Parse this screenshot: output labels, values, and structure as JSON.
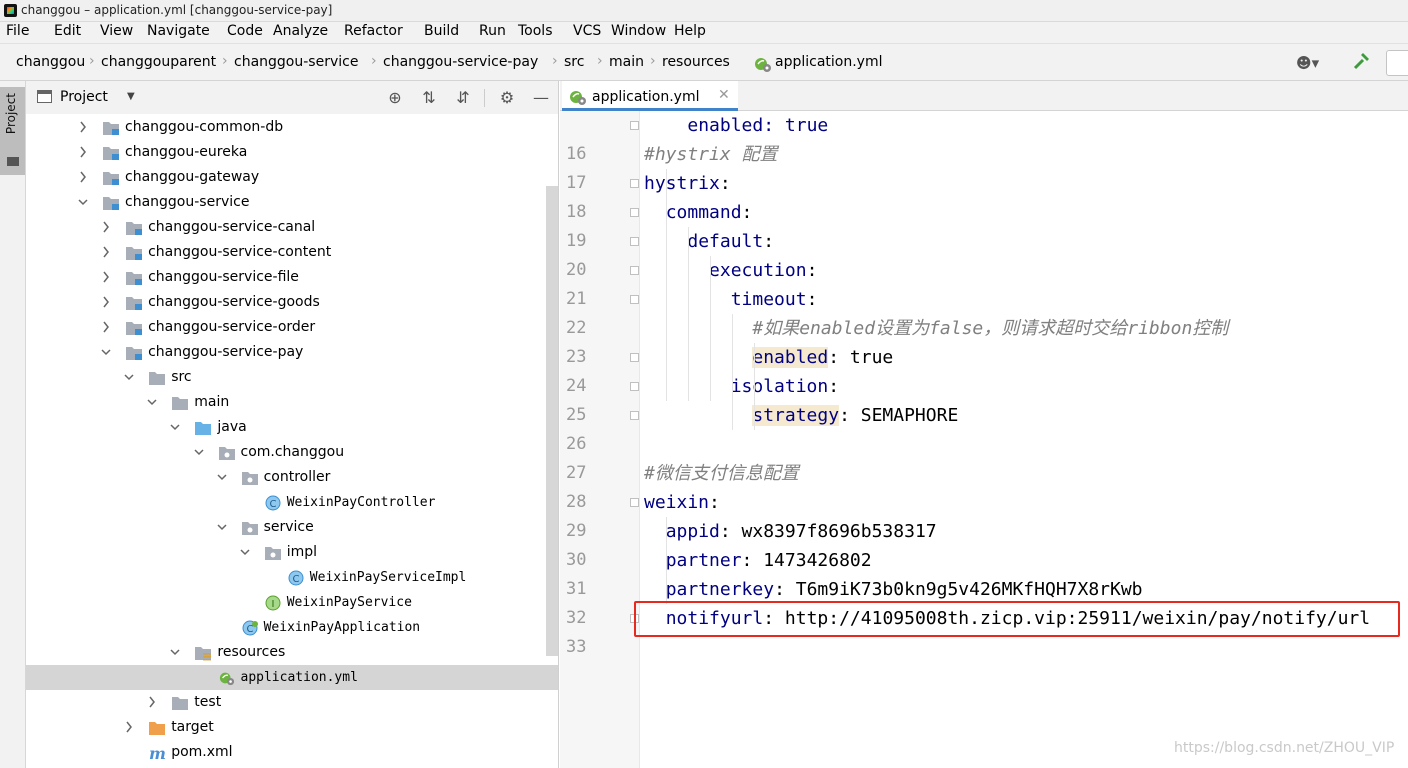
{
  "window": {
    "title": "changgou – application.yml [changgou-service-pay]"
  },
  "menu": [
    "File",
    "Edit",
    "View",
    "Navigate",
    "Code",
    "Analyze",
    "Refactor",
    "Build",
    "Run",
    "Tools",
    "VCS",
    "Window",
    "Help"
  ],
  "breadcrumb": [
    "changgou",
    "changgouparent",
    "changgou-service",
    "changgou-service-pay",
    "src",
    "main",
    "resources",
    "application.yml"
  ],
  "project_panel": {
    "title": "Project",
    "side_tab": "Project",
    "tree": [
      {
        "label": "changgou-common-db",
        "expanded": false,
        "icon": "module-folder-icon"
      },
      {
        "label": "changgou-eureka",
        "expanded": false,
        "icon": "module-folder-icon"
      },
      {
        "label": "changgou-gateway",
        "expanded": false,
        "icon": "module-folder-icon"
      },
      {
        "label": "changgou-service",
        "expanded": true,
        "icon": "module-folder-icon"
      },
      {
        "label": "changgou-service-canal",
        "expanded": false,
        "icon": "module-folder-icon"
      },
      {
        "label": "changgou-service-content",
        "expanded": false,
        "icon": "module-folder-icon"
      },
      {
        "label": "changgou-service-file",
        "expanded": false,
        "icon": "module-folder-icon"
      },
      {
        "label": "changgou-service-goods",
        "expanded": false,
        "icon": "module-folder-icon"
      },
      {
        "label": "changgou-service-order",
        "expanded": false,
        "icon": "module-folder-icon"
      },
      {
        "label": "changgou-service-pay",
        "expanded": true,
        "icon": "module-folder-icon"
      },
      {
        "label": "src",
        "expanded": true,
        "icon": "folder-icon"
      },
      {
        "label": "main",
        "expanded": true,
        "icon": "folder-icon"
      },
      {
        "label": "java",
        "expanded": true,
        "icon": "source-folder-icon"
      },
      {
        "label": "com.changgou",
        "expanded": true,
        "icon": "package-icon"
      },
      {
        "label": "controller",
        "expanded": true,
        "icon": "package-icon"
      },
      {
        "label": "WeixinPayController",
        "icon": "class-icon"
      },
      {
        "label": "service",
        "expanded": true,
        "icon": "package-icon"
      },
      {
        "label": "impl",
        "expanded": true,
        "icon": "package-icon"
      },
      {
        "label": "WeixinPayServiceImpl",
        "icon": "class-icon"
      },
      {
        "label": "WeixinPayService",
        "icon": "interface-icon"
      },
      {
        "label": "WeixinPayApplication",
        "icon": "spring-boot-class-icon"
      },
      {
        "label": "resources",
        "expanded": true,
        "icon": "resources-folder-icon"
      },
      {
        "label": "application.yml",
        "icon": "yml-file-icon",
        "selected": true
      },
      {
        "label": "test",
        "expanded": false,
        "icon": "folder-icon"
      },
      {
        "label": "target",
        "expanded": false,
        "icon": "excluded-folder-icon"
      },
      {
        "label": "pom.xml",
        "icon": "maven-icon"
      }
    ]
  },
  "editor": {
    "tab": "application.yml",
    "lines": [
      {
        "n": "16",
        "parts": [
          {
            "t": "    ",
            "c": "val"
          },
          {
            "t": "enabled",
            "c": "key"
          },
          {
            "t": ": true",
            "c": "key"
          }
        ]
      },
      {
        "n": "17",
        "parts": [
          {
            "t": "#hystrix 配置",
            "c": "comment"
          }
        ]
      },
      {
        "n": "18",
        "parts": [
          {
            "t": "hystrix",
            "c": "key"
          },
          {
            "t": ":",
            "c": "val"
          }
        ]
      },
      {
        "n": "19",
        "parts": [
          {
            "t": "  ",
            "c": "val"
          },
          {
            "t": "command",
            "c": "key"
          },
          {
            "t": ":",
            "c": "val"
          }
        ]
      },
      {
        "n": "20",
        "parts": [
          {
            "t": "    ",
            "c": "val"
          },
          {
            "t": "default",
            "c": "key"
          },
          {
            "t": ":",
            "c": "val"
          }
        ]
      },
      {
        "n": "21",
        "parts": [
          {
            "t": "      ",
            "c": "val"
          },
          {
            "t": "execution",
            "c": "key"
          },
          {
            "t": ":",
            "c": "val"
          }
        ]
      },
      {
        "n": "22",
        "parts": [
          {
            "t": "        ",
            "c": "val"
          },
          {
            "t": "timeout",
            "c": "key"
          },
          {
            "t": ":",
            "c": "val"
          }
        ]
      },
      {
        "n": "23",
        "parts": [
          {
            "t": "          ",
            "c": "val"
          },
          {
            "t": "#如果enabled设置为false，则请求超时交给ribbon控制",
            "c": "comment"
          }
        ]
      },
      {
        "n": "24",
        "parts": [
          {
            "t": "          ",
            "c": "val"
          },
          {
            "t": "enabled",
            "c": "key-hl"
          },
          {
            "t": ": true",
            "c": "val"
          }
        ]
      },
      {
        "n": "25",
        "parts": [
          {
            "t": "        ",
            "c": "val"
          },
          {
            "t": "isolation",
            "c": "key"
          },
          {
            "t": ":",
            "c": "val"
          }
        ]
      },
      {
        "n": "26",
        "parts": [
          {
            "t": "          ",
            "c": "val"
          },
          {
            "t": "strategy",
            "c": "key-hl"
          },
          {
            "t": ": SEMAPHORE",
            "c": "val"
          }
        ]
      },
      {
        "n": "27",
        "parts": []
      },
      {
        "n": "28",
        "parts": [
          {
            "t": "#微信支付信息配置",
            "c": "comment"
          }
        ]
      },
      {
        "n": "29",
        "parts": [
          {
            "t": "weixin",
            "c": "key"
          },
          {
            "t": ":",
            "c": "val"
          }
        ]
      },
      {
        "n": "30",
        "parts": [
          {
            "t": "  ",
            "c": "val"
          },
          {
            "t": "appid",
            "c": "key"
          },
          {
            "t": ": wx8397f8696b538317",
            "c": "val"
          }
        ]
      },
      {
        "n": "31",
        "parts": [
          {
            "t": "  ",
            "c": "val"
          },
          {
            "t": "partner",
            "c": "key"
          },
          {
            "t": ": 1473426802",
            "c": "val"
          }
        ]
      },
      {
        "n": "32",
        "parts": [
          {
            "t": "  ",
            "c": "val"
          },
          {
            "t": "partnerkey",
            "c": "key"
          },
          {
            "t": ": T6m9iK73b0kn9g5v426MKfHQH7X8rKwb",
            "c": "val"
          }
        ]
      },
      {
        "n": "33",
        "parts": [
          {
            "t": "  ",
            "c": "val"
          },
          {
            "t": "notifyurl",
            "c": "key"
          },
          {
            "t": ": http://41095008th.zicp.vip:25911/weixin/pay/notify/url",
            "c": "val"
          }
        ]
      }
    ]
  },
  "watermark": "https://blog.csdn.net/ZHOU_VIP",
  "colors": {
    "accent": "#4083c9",
    "highlight_box": "#e8291d",
    "key": "#000080",
    "comment": "#808080"
  }
}
